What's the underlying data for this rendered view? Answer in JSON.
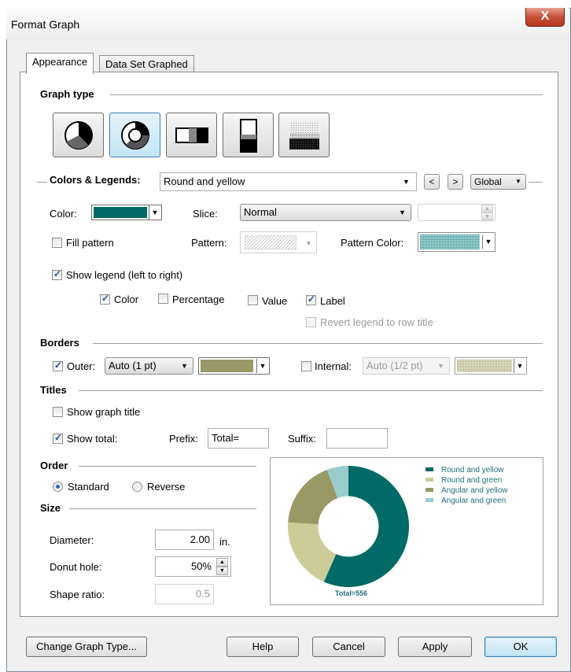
{
  "window": {
    "title": "Format Graph",
    "close_label": "X"
  },
  "tabs": [
    {
      "label": "Appearance",
      "active": true
    },
    {
      "label": "Data Set Graphed",
      "active": false
    }
  ],
  "graph_type": {
    "section_label": "Graph type",
    "buttons": [
      {
        "name": "pie",
        "selected": false
      },
      {
        "name": "donut",
        "selected": true
      },
      {
        "name": "horizontal-bar",
        "selected": false
      },
      {
        "name": "vertical-bar",
        "selected": false
      },
      {
        "name": "dot-grid",
        "selected": false
      }
    ]
  },
  "colors_legends": {
    "section_label": "Colors & Legends:",
    "dataset_value": "Round and yellow",
    "prev_label": "<",
    "next_label": ">",
    "scope_value": "Global",
    "color_label": "Color:",
    "color_value": "#006a66",
    "slice_label": "Slice:",
    "slice_value": "Normal",
    "slice_offset_value": "",
    "fill_pattern_label": "Fill pattern",
    "fill_pattern_checked": false,
    "pattern_label": "Pattern:",
    "pattern_color_label": "Pattern Color:",
    "pattern_color_value": "#3a9a98",
    "show_legend_label": "Show legend (left to right)",
    "show_legend_checked": true,
    "legend_options": [
      {
        "label": "Color",
        "checked": true
      },
      {
        "label": "Percentage",
        "checked": false
      },
      {
        "label": "Value",
        "checked": false
      },
      {
        "label": "Label",
        "checked": true
      }
    ],
    "revert_label": "Revert legend to row title",
    "revert_checked": false
  },
  "borders": {
    "section_label": "Borders",
    "outer_label": "Outer:",
    "outer_checked": true,
    "outer_value": "Auto (1 pt)",
    "outer_color": "#989868",
    "internal_label": "Internal:",
    "internal_checked": false,
    "internal_value": "Auto (1/2 pt)",
    "internal_color": "#b0b088"
  },
  "titles": {
    "section_label": "Titles",
    "show_graph_title_label": "Show graph title",
    "show_graph_title_checked": false,
    "show_total_label": "Show total:",
    "show_total_checked": true,
    "prefix_label": "Prefix:",
    "prefix_value": "Total=",
    "suffix_label": "Suffix:",
    "suffix_value": ""
  },
  "order": {
    "section_label": "Order",
    "standard_label": "Standard",
    "reverse_label": "Reverse",
    "selected": "standard"
  },
  "size": {
    "section_label": "Size",
    "diameter_label": "Diameter:",
    "diameter_value": "2.00",
    "diameter_unit": "in.",
    "donut_hole_label": "Donut hole:",
    "donut_hole_value": "50%",
    "shape_ratio_label": "Shape ratio:",
    "shape_ratio_value": "0.5"
  },
  "chart_data": {
    "type": "pie",
    "variant": "donut",
    "hole_fraction": 0.5,
    "categories": [
      "Round and yellow",
      "Round and green",
      "Angular and yellow",
      "Angular and green"
    ],
    "values": [
      315,
      108,
      101,
      32
    ],
    "colors": [
      "#006a66",
      "#cccc99",
      "#999966",
      "#99cccc"
    ],
    "legend_placement": "top-right",
    "total_text": "Total=556"
  },
  "footer": {
    "change_graph_type_label": "Change Graph Type...",
    "help_label": "Help",
    "cancel_label": "Cancel",
    "apply_label": "Apply",
    "ok_label": "OK"
  }
}
